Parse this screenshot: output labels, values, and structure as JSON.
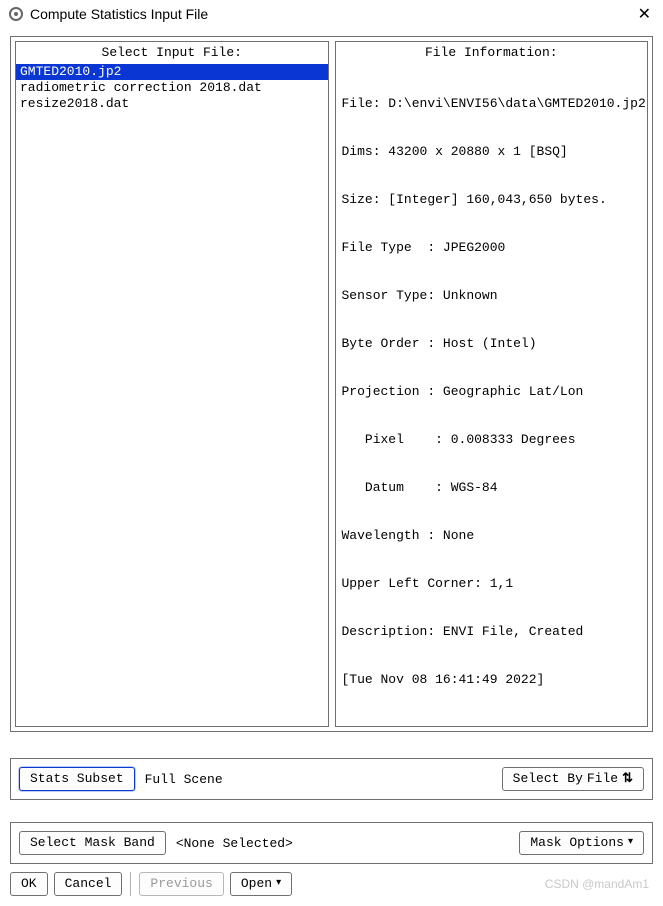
{
  "window": {
    "title": "Compute Statistics Input File"
  },
  "panels": {
    "left": {
      "title": "Select Input File:",
      "files": [
        "GMTED2010.jp2",
        "radiometric correction 2018.dat",
        "resize2018.dat"
      ]
    },
    "right": {
      "title": "File Information:",
      "lines": [
        "File: D:\\envi\\ENVI56\\data\\GMTED2010.jp2",
        "Dims: 43200 x 20880 x 1 [BSQ]",
        "Size: [Integer] 160,043,650 bytes.",
        "File Type  : JPEG2000",
        "Sensor Type: Unknown",
        "Byte Order : Host (Intel)",
        "Projection : Geographic Lat/Lon",
        "   Pixel    : 0.008333 Degrees",
        "   Datum    : WGS-84",
        "Wavelength : None",
        "Upper Left Corner: 1,1",
        "Description: ENVI File, Created",
        "[Tue Nov 08 16:41:49 2022]"
      ]
    }
  },
  "subset": {
    "stats_subset_label": "Stats Subset",
    "stats_subset_value": "Full Scene",
    "select_by_label": "Select By",
    "select_by_value": "File"
  },
  "mask": {
    "select_mask_band_label": "Select Mask Band",
    "select_mask_band_value": "<None Selected>",
    "mask_options_label": "Mask Options"
  },
  "buttons": {
    "ok": "OK",
    "cancel": "Cancel",
    "previous": "Previous",
    "open": "Open"
  },
  "watermark": "CSDN @mandAm1"
}
